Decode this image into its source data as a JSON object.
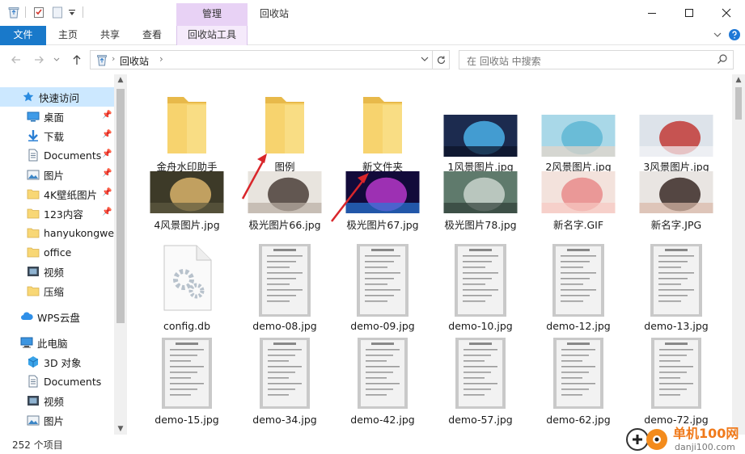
{
  "window": {
    "title": "回收站",
    "manage_tab": "管理",
    "minimize": "—",
    "maximize": "☐",
    "close": "✕"
  },
  "ribbon": {
    "tabs": [
      {
        "label": "文件",
        "active": true
      },
      {
        "label": "主页"
      },
      {
        "label": "共享"
      },
      {
        "label": "查看"
      },
      {
        "label": "回收站工具"
      }
    ]
  },
  "addressbar": {
    "crumb": "回收站",
    "search_placeholder": "在 回收站 中搜索"
  },
  "navigation": {
    "items": [
      {
        "label": "快速访问",
        "icon": "star-icon",
        "pinned": false,
        "selected": true
      },
      {
        "label": "桌面",
        "icon": "desktop-icon",
        "pinned": true
      },
      {
        "label": "下载",
        "icon": "download-icon",
        "pinned": true
      },
      {
        "label": "Documents",
        "icon": "document-icon",
        "pinned": true
      },
      {
        "label": "图片",
        "icon": "pictures-icon",
        "pinned": true
      },
      {
        "label": "4K壁纸图片",
        "icon": "folder-icon",
        "pinned": true
      },
      {
        "label": "123内容",
        "icon": "folder-icon",
        "pinned": true
      },
      {
        "label": "hanyukongwen",
        "icon": "folder-icon",
        "pinned": false
      },
      {
        "label": "office",
        "icon": "folder-icon",
        "pinned": false
      },
      {
        "label": "视频",
        "icon": "video-icon",
        "pinned": false
      },
      {
        "label": "压缩",
        "icon": "folder-icon",
        "pinned": false
      },
      {
        "label": "WPS云盘",
        "icon": "cloud-icon",
        "pinned": false
      },
      {
        "label": "此电脑",
        "icon": "computer-icon",
        "pinned": false
      },
      {
        "label": "3D 对象",
        "icon": "3d-objects-icon",
        "pinned": false
      },
      {
        "label": "Documents",
        "icon": "document-icon",
        "pinned": false
      },
      {
        "label": "视频",
        "icon": "video-icon",
        "pinned": false
      },
      {
        "label": "图片",
        "icon": "pictures-icon",
        "pinned": false
      }
    ]
  },
  "files": [
    {
      "name": "金舟水印助手",
      "kind": "folder"
    },
    {
      "name": "图例",
      "kind": "folder"
    },
    {
      "name": "新文件夹",
      "kind": "folder"
    },
    {
      "name": "1风景图片.jpg",
      "kind": "image",
      "palette": [
        "#1c2b4f",
        "#4ab0e8",
        "#0b1226"
      ]
    },
    {
      "name": "2风景图片.jpg",
      "kind": "image",
      "palette": [
        "#a9d8e8",
        "#5fb7d4",
        "#e8d6c8"
      ]
    },
    {
      "name": "3风景图片.jpg",
      "kind": "image",
      "palette": [
        "#dde3ea",
        "#c23a36",
        "#f4f4f6"
      ]
    },
    {
      "name": "4风景图片.jpg",
      "kind": "image",
      "palette": [
        "#3d3a28",
        "#d8b36a",
        "#5e5a40"
      ]
    },
    {
      "name": "极光图片66.jpg",
      "kind": "image",
      "palette": [
        "#e8e4de",
        "#4a3e38",
        "#b9aea4"
      ]
    },
    {
      "name": "极光图片67.jpg",
      "kind": "image",
      "palette": [
        "#120a3a",
        "#b637c9",
        "#2a78d8"
      ]
    },
    {
      "name": "极光图片78.jpg",
      "kind": "image",
      "palette": [
        "#5f7a6c",
        "#c9d3cc",
        "#2f3e38"
      ]
    },
    {
      "name": "新名字.GIF",
      "kind": "image",
      "palette": [
        "#f3e2dc",
        "#e88b8b",
        "#f7c9c2"
      ]
    },
    {
      "name": "新名字.JPG",
      "kind": "image",
      "palette": [
        "#e9e5e2",
        "#3a2a26",
        "#d9b8a8"
      ]
    },
    {
      "name": "config.db",
      "kind": "generic"
    },
    {
      "name": "demo-08.jpg",
      "kind": "document"
    },
    {
      "name": "demo-09.jpg",
      "kind": "document"
    },
    {
      "name": "demo-10.jpg",
      "kind": "document"
    },
    {
      "name": "demo-12.jpg",
      "kind": "document"
    },
    {
      "name": "demo-13.jpg",
      "kind": "document"
    },
    {
      "name": "demo-15.jpg",
      "kind": "document"
    },
    {
      "name": "demo-34.jpg",
      "kind": "document"
    },
    {
      "name": "demo-42.jpg",
      "kind": "document"
    },
    {
      "name": "demo-57.jpg",
      "kind": "document"
    },
    {
      "name": "demo-62.jpg",
      "kind": "document"
    },
    {
      "name": "demo-72.jpg",
      "kind": "document"
    }
  ],
  "status": {
    "item_count": "252 个项目"
  },
  "watermark": {
    "brand": "单机100网",
    "url": "danji100.com"
  },
  "colors": {
    "accent_blue": "#1979ca",
    "manage_purple": "#e8d2f5",
    "selection_blue": "#cce8ff",
    "folder_yellow": "#f8d775",
    "annotation_red": "#d9262b"
  }
}
